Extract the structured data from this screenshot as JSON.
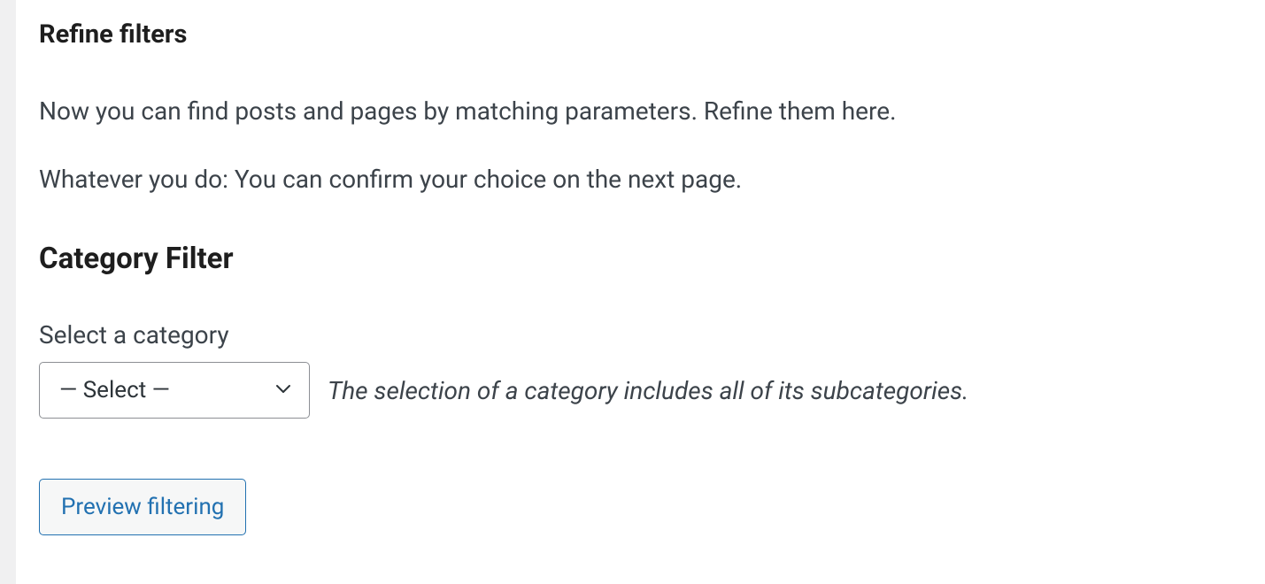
{
  "refine": {
    "title": "Refine filters",
    "description1": "Now you can find posts and pages by matching parameters. Refine them here.",
    "description2": "Whatever you do: You can confirm your choice on the next page."
  },
  "categoryFilter": {
    "title": "Category Filter",
    "label": "Select a category",
    "selectedOption": "— Select —",
    "hint": "The selection of a category includes all of its subcategories."
  },
  "actions": {
    "previewButton": "Preview filtering"
  }
}
